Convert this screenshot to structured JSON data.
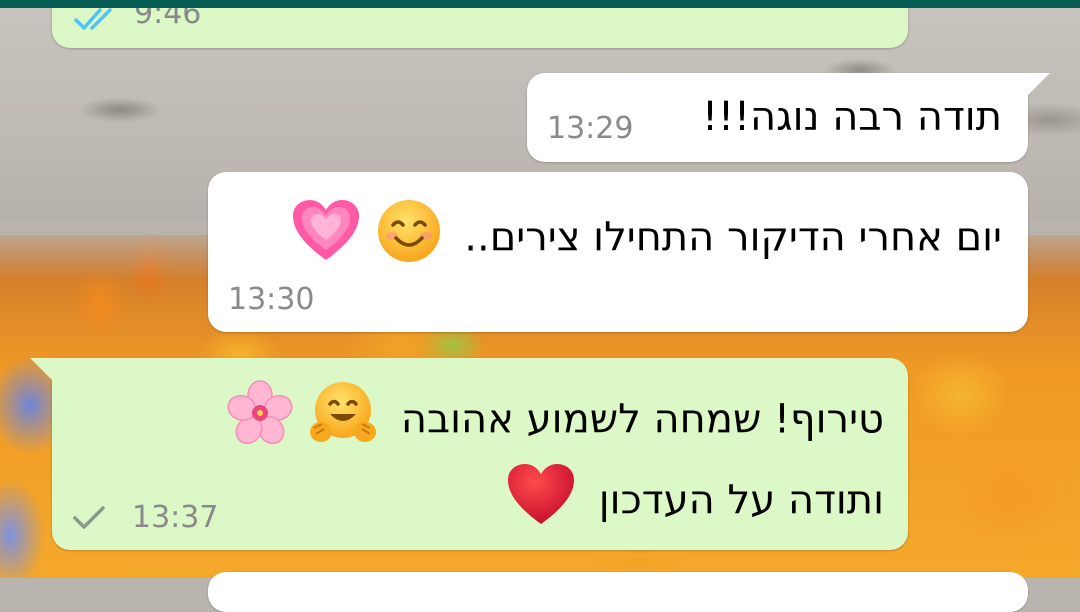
{
  "messages": [
    {
      "id": "m0",
      "direction": "outgoing",
      "text": "",
      "time": "9:46",
      "status": "read",
      "status_icon": "double-check-icon"
    },
    {
      "id": "m1",
      "direction": "incoming",
      "text": "תודה רבה נוגה!!!",
      "time": "13:29"
    },
    {
      "id": "m2",
      "direction": "incoming",
      "text": "יום אחרי הדיקור התחילו צירים..",
      "emojis": [
        "smiling-face-icon",
        "growing-heart-icon"
      ],
      "time": "13:30"
    },
    {
      "id": "m3",
      "direction": "outgoing",
      "lines": [
        "טירוף! שמחה לשמוע אהובה",
        "ותודה על העדכון"
      ],
      "emojis_line1": [
        "hugging-face-icon",
        "cherry-blossom-icon"
      ],
      "emojis_line2": [
        "red-heart-icon"
      ],
      "time": "13:37",
      "status": "sent",
      "status_icon": "single-check-icon"
    }
  ],
  "colors": {
    "incoming_bubble": "#ffffff",
    "outgoing_bubble": "#dcf8c6",
    "header": "#075e54",
    "timestamp": "#8a8a8a",
    "read_check": "#4fc3f7",
    "sent_check": "#8a9a8a"
  }
}
